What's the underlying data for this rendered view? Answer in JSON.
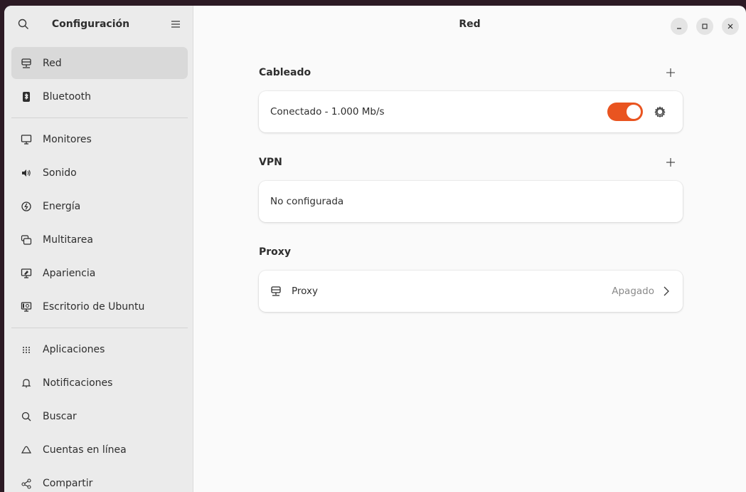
{
  "sidebar": {
    "title": "Configuración",
    "groups": [
      [
        {
          "label": "Red",
          "icon": "network-icon",
          "active": true
        },
        {
          "label": "Bluetooth",
          "icon": "bluetooth-icon"
        }
      ],
      [
        {
          "label": "Monitores",
          "icon": "monitor-icon"
        },
        {
          "label": "Sonido",
          "icon": "speaker-icon"
        },
        {
          "label": "Energía",
          "icon": "power-icon"
        },
        {
          "label": "Multitarea",
          "icon": "multitask-icon"
        },
        {
          "label": "Apariencia",
          "icon": "appearance-icon"
        },
        {
          "label": "Escritorio de Ubuntu",
          "icon": "ubuntu-desktop-icon"
        }
      ],
      [
        {
          "label": "Aplicaciones",
          "icon": "apps-grid-icon"
        },
        {
          "label": "Notificaciones",
          "icon": "bell-icon"
        },
        {
          "label": "Buscar",
          "icon": "search-icon"
        },
        {
          "label": "Cuentas en línea",
          "icon": "cloud-icon"
        },
        {
          "label": "Compartir",
          "icon": "share-icon"
        }
      ]
    ]
  },
  "main": {
    "title": "Red",
    "wired": {
      "title": "Cableado",
      "status": "Conectado - 1.000 Mb/s",
      "enabled": true
    },
    "vpn": {
      "title": "VPN",
      "status": "No configurada"
    },
    "proxy": {
      "title": "Proxy",
      "row_label": "Proxy",
      "status": "Apagado"
    }
  },
  "colors": {
    "accent": "#e95420"
  }
}
